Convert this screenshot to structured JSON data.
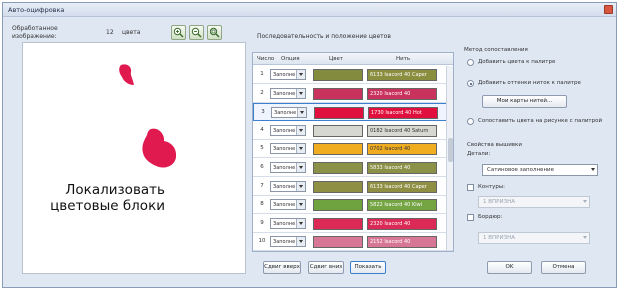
{
  "window": {
    "title": "Авто-оцифровка"
  },
  "processed": {
    "label": "Обработанное изображение:",
    "count": "12",
    "unit": "цвета"
  },
  "zoom_icons": [
    "zoom-in-icon",
    "zoom-out-icon",
    "zoom-fit-icon"
  ],
  "preview": {
    "caption": "Локализовать цветовые блоки",
    "blob_color": "#e01a4f"
  },
  "sequence": {
    "title": "Последовательность и положение цветов",
    "headers": [
      "Число",
      "Опция",
      "Цвет",
      "Нить"
    ],
    "rows": [
      {
        "num": "1",
        "option": "Заполне",
        "color": "#838b3f",
        "thread": "6133 Isacord 40 Caper",
        "thread_bg": "#8a8f3f",
        "thread_fg": "#ffffff"
      },
      {
        "num": "2",
        "option": "Заполне",
        "color": "#c8325c",
        "thread": "2320 Isacord 40",
        "thread_bg": "#c8325c",
        "thread_fg": "#ffffff"
      },
      {
        "num": "3",
        "option": "Заполне",
        "color": "#e00f3d",
        "thread": "1730 Isacord 40 Hot",
        "thread_bg": "#e00f3d",
        "thread_fg": "#ffffff"
      },
      {
        "num": "4",
        "option": "Заполне",
        "color": "#d6d7d0",
        "thread": "0182 Isacord 40 Saturn",
        "thread_bg": "#d7d8d2",
        "thread_fg": "#333333"
      },
      {
        "num": "5",
        "option": "Заполне",
        "color": "#efad1f",
        "thread": "0702 Isacord 40",
        "thread_bg": "#efad1f",
        "thread_fg": "#333333"
      },
      {
        "num": "6",
        "option": "Заполне",
        "color": "#8b9147",
        "thread": "5833 Isacord 40",
        "thread_bg": "#8b9147",
        "thread_fg": "#ffffff"
      },
      {
        "num": "7",
        "option": "Заполне",
        "color": "#8f8f43",
        "thread": "6133 Isacord 40 Caper",
        "thread_bg": "#8f8f43",
        "thread_fg": "#ffffff"
      },
      {
        "num": "8",
        "option": "Заполне",
        "color": "#6fa33f",
        "thread": "5822 Isacord 40 Kiwi",
        "thread_bg": "#74a542",
        "thread_fg": "#ffffff"
      },
      {
        "num": "9",
        "option": "Заполне",
        "color": "#db2a55",
        "thread": "2320 Isacord 40",
        "thread_bg": "#db2a55",
        "thread_fg": "#ffffff"
      },
      {
        "num": "10",
        "option": "Заполне",
        "color": "#d87795",
        "thread": "2152 Isacord 40",
        "thread_bg": "#d87795",
        "thread_fg": "#ffffff"
      }
    ]
  },
  "bottom_buttons": {
    "shift_up": "Сдвиг вверх",
    "shift_down": "Сдвиг вниз",
    "show": "Показать"
  },
  "method": {
    "title": "Метод сопоставления",
    "options": [
      {
        "label": "Добавить цвета к палитре",
        "selected": false
      },
      {
        "label": "Добавить оттенки ниток к палитре",
        "selected": true
      },
      {
        "label": "Сопоставить цвета на рисунке с палитрой",
        "selected": false
      }
    ],
    "thread_maps_button": "Мои карты нитей..."
  },
  "embroidery": {
    "title": "Свойства вышивки",
    "details_label": "Детали:",
    "details_value": "Сатиновое заполнение",
    "outline_label": "Контуры:",
    "outline_value": "1 ВПРИЗНА",
    "border_label": "Бордюр:",
    "border_value": "1 ВПРИЗНА"
  },
  "dialog_buttons": {
    "ok": "OK",
    "cancel": "Отмена"
  }
}
